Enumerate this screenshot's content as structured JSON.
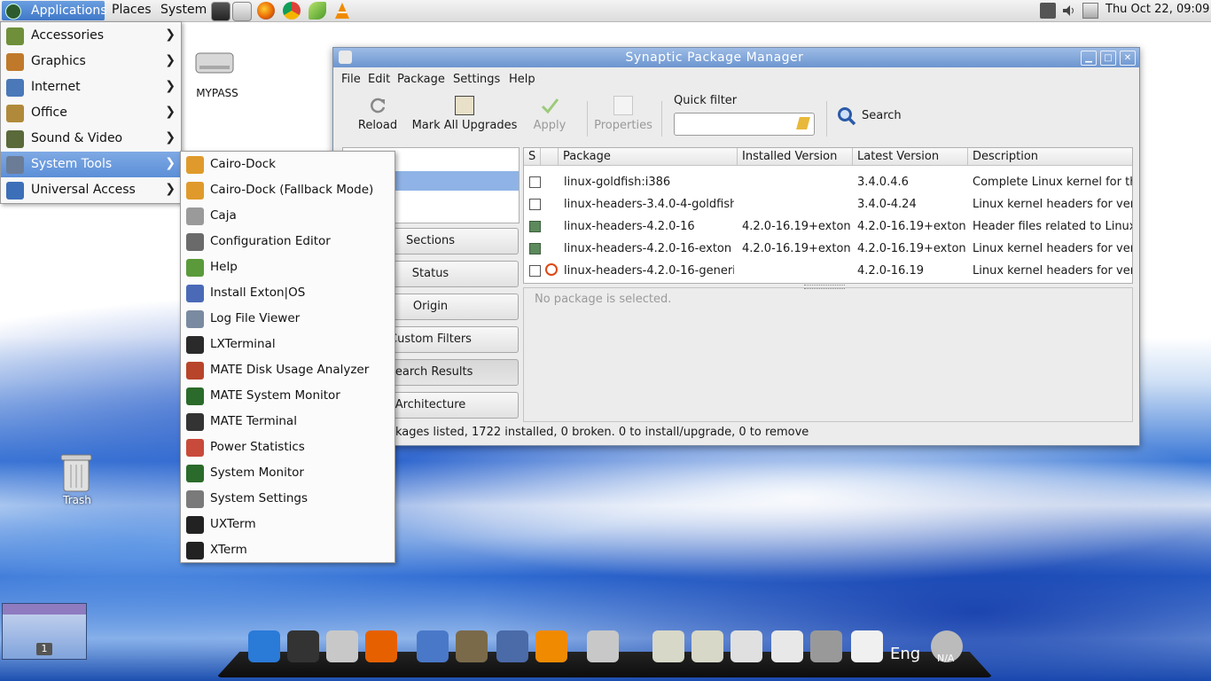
{
  "top_panel": {
    "applications_label": "Applications",
    "places_label": "Places",
    "system_label": "System",
    "clock": "Thu Oct 22, 09:09",
    "launchers": [
      "terminal-icon",
      "synaptic-icon",
      "firefox-icon",
      "chrome-icon",
      "leaf-icon",
      "vlc-icon"
    ],
    "tray": [
      "network-icon",
      "volume-icon",
      "files-icon"
    ]
  },
  "desktop": {
    "drive_label": "MYPASS",
    "trash_label": "Trash",
    "workspace_number": "1"
  },
  "app_menu": {
    "items": [
      {
        "label": "Accessories",
        "icon": "accessories-icon",
        "color": "#6f8f3a"
      },
      {
        "label": "Graphics",
        "icon": "graphics-icon",
        "color": "#c0792b"
      },
      {
        "label": "Internet",
        "icon": "internet-icon",
        "color": "#4a78b8"
      },
      {
        "label": "Office",
        "icon": "office-icon",
        "color": "#b08a3a"
      },
      {
        "label": "Sound & Video",
        "icon": "sound-video-icon",
        "color": "#5a6a3a"
      },
      {
        "label": "System Tools",
        "icon": "system-tools-icon",
        "color": "#6b7c96"
      },
      {
        "label": "Universal Access",
        "icon": "universal-access-icon",
        "color": "#3d6fb8"
      }
    ],
    "arrow": "❯"
  },
  "submenu": {
    "items": [
      {
        "label": "Cairo-Dock",
        "color": "#e09a2c"
      },
      {
        "label": "Cairo-Dock (Fallback Mode)",
        "color": "#e09a2c"
      },
      {
        "label": "Caja",
        "color": "#9a9a9a"
      },
      {
        "label": "Configuration Editor",
        "color": "#6a6a6a"
      },
      {
        "label": "Help",
        "color": "#5a9a3a"
      },
      {
        "label": "Install Exton|OS",
        "color": "#4a6ab8"
      },
      {
        "label": "Log File Viewer",
        "color": "#7a8aa0"
      },
      {
        "label": "LXTerminal",
        "color": "#2a2a2a"
      },
      {
        "label": "MATE Disk Usage Analyzer",
        "color": "#b8452a"
      },
      {
        "label": "MATE System Monitor",
        "color": "#2a6a2a"
      },
      {
        "label": "MATE Terminal",
        "color": "#333333"
      },
      {
        "label": "Power Statistics",
        "color": "#c84a3a"
      },
      {
        "label": "System Monitor",
        "color": "#2a6a2a"
      },
      {
        "label": "System Settings",
        "color": "#7a7a7a"
      },
      {
        "label": "UXTerm",
        "color": "#222222"
      },
      {
        "label": "XTerm",
        "color": "#222222"
      }
    ]
  },
  "synaptic": {
    "title": "Synaptic Package Manager",
    "menu": [
      "File",
      "Edit",
      "Package",
      "Settings",
      "Help"
    ],
    "toolbar": {
      "reload": "Reload",
      "mark_all": "Mark All Upgrades",
      "apply": "Apply",
      "properties": "Properties",
      "quick_filter": "Quick filter",
      "search": "Search"
    },
    "filters": [
      "Sections",
      "Status",
      "Origin",
      "Custom Filters",
      "Search Results",
      "Architecture"
    ],
    "columns": [
      "S",
      "Package",
      "Installed Version",
      "Latest Version",
      "Description"
    ],
    "rows": [
      {
        "status": "none",
        "ubuntu": false,
        "package": "linux-goldfish:i386",
        "installed": "",
        "latest": "3.4.0.4.6",
        "description": "Complete Linux kernel for th"
      },
      {
        "status": "none",
        "ubuntu": false,
        "package": "linux-headers-3.4.0-4-goldfish",
        "installed": "",
        "latest": "3.4.0-4.24",
        "description": "Linux kernel headers for vers"
      },
      {
        "status": "installed",
        "ubuntu": false,
        "package": "linux-headers-4.2.0-16",
        "installed": "4.2.0-16.19+exton",
        "latest": "4.2.0-16.19+exton",
        "description": "Header files related to Linux"
      },
      {
        "status": "installed",
        "ubuntu": false,
        "package": "linux-headers-4.2.0-16-exton",
        "installed": "4.2.0-16.19+exton",
        "latest": "4.2.0-16.19+exton",
        "description": "Linux kernel headers for vers"
      },
      {
        "status": "none",
        "ubuntu": true,
        "package": "linux-headers-4.2.0-16-generic",
        "installed": "",
        "latest": "4.2.0-16.19",
        "description": "Linux kernel headers for vers"
      }
    ],
    "details": "No package is selected.",
    "status_bar": "kages listed, 1722 installed, 0 broken. 0 to install/upgrade, 0 to remove"
  },
  "dock": {
    "items": [
      "exton-icon",
      "monitor-icon",
      "synaptic-dock-icon",
      "firefox-dock-icon",
      "image-viewer-icon",
      "gimp-icon",
      "calculator-icon",
      "vlc-dock-icon",
      "package-installer-icon",
      "home-folder-icon",
      "folder-icon",
      "search-tool-icon",
      "settings-window-icon",
      "volume-dock-icon",
      "switch-icon",
      "network-dock-icon"
    ],
    "lang": "Eng",
    "net": "N/A"
  }
}
